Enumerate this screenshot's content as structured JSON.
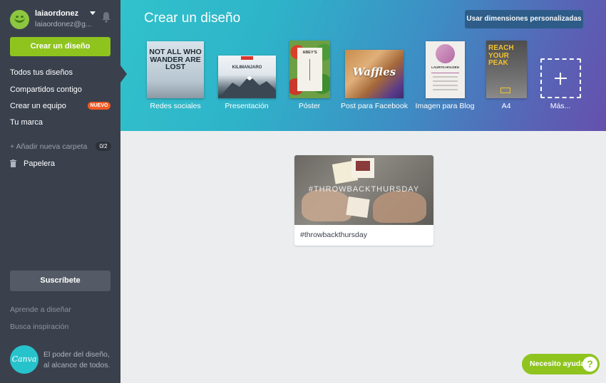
{
  "user": {
    "name": "laiaordonez",
    "email": "laiaordonez@g..."
  },
  "sidebar": {
    "create_label": "Crear un diseño",
    "items": [
      {
        "label": "Todos tus diseños"
      },
      {
        "label": "Compartidos contigo"
      },
      {
        "label": "Crear un equipo",
        "badge": "NUEVO"
      },
      {
        "label": "Tu marca"
      }
    ],
    "add_folder": "+ Añadir nueva carpeta",
    "folder_count": "0/2",
    "trash": "Papelera",
    "subscribe": "Suscríbete",
    "links": [
      "Aprende a diseñar",
      "Busca inspiración"
    ],
    "logo_text": "Canva",
    "slogan": "El poder del diseño, al alcance de todos."
  },
  "header": {
    "title": "Crear un diseño",
    "custom_button": "Usar dimensiones personalizadas",
    "templates": [
      {
        "label": "Redes sociales",
        "thumb_text": "NOT ALL WHO WANDER ARE LOST"
      },
      {
        "label": "Presentación",
        "thumb_text": "KILIMANJARO"
      },
      {
        "label": "Póster",
        "thumb_text": "ABEY'S"
      },
      {
        "label": "Post para Facebook",
        "thumb_text": "Waffles"
      },
      {
        "label": "Imagen para Blog",
        "thumb_text": "LAURYN HOLDEN"
      },
      {
        "label": "A4",
        "thumb_text": "REACH YOUR PEAK"
      },
      {
        "label": "Más..."
      }
    ]
  },
  "designs": [
    {
      "title": "#throwbackthursday",
      "overlay": "#THROWBACKTHURSDAY"
    }
  ],
  "help": {
    "label": "Necesito ayuda",
    "icon": "?"
  },
  "colors": {
    "sidebar": "#3a414d",
    "accent_green": "#8fc41f",
    "badge_orange": "#f15a24"
  }
}
